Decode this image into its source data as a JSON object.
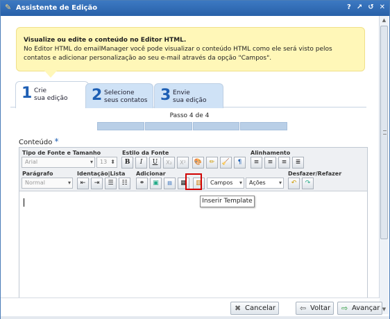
{
  "window": {
    "title": "Assistente de Edição",
    "controls": [
      "?",
      "↗",
      "↺",
      "✕"
    ]
  },
  "info": {
    "title": "Visualize ou edite o conteúdo no Editor HTML.",
    "text": "No Editor HTML do emailManager você pode visualizar o conteúdo HTML como ele será visto pelos contatos e adicionar personalização ao seu e-mail através da opção \"Campos\"."
  },
  "tabs": [
    {
      "num": "1",
      "line1": "Crie",
      "line2": "sua edição"
    },
    {
      "num": "2",
      "line1": "Selecione",
      "line2": "seus contatos"
    },
    {
      "num": "3",
      "line1": "Envie",
      "line2": "sua edição"
    }
  ],
  "progress": {
    "label": "Passo 4 de 4",
    "steps": 4
  },
  "content": {
    "label": "Conteúdo",
    "required_mark": "*"
  },
  "toolbar": {
    "font_group": "Tipo de Fonte e Tamanho",
    "font_value": "Arial",
    "size_value": "13",
    "style_group": "Estilo da Fonte",
    "align_group": "Alinhamento",
    "paragraph_group": "Parágrafo",
    "paragraph_value": "Normal",
    "indent_group": "Identação|Lista",
    "add_group": "Adicionar",
    "undo_group": "Desfazer/Refazer",
    "campos": "Campos",
    "acoes": "Ações",
    "bold": "B",
    "italic": "I",
    "underline": "U",
    "subscript": "X₂",
    "superscript": "X²",
    "pilcrow": "¶"
  },
  "tooltip": "Inserir Template",
  "footer": {
    "cancel": "Cancelar",
    "back": "Voltar",
    "next": "Avançar"
  }
}
